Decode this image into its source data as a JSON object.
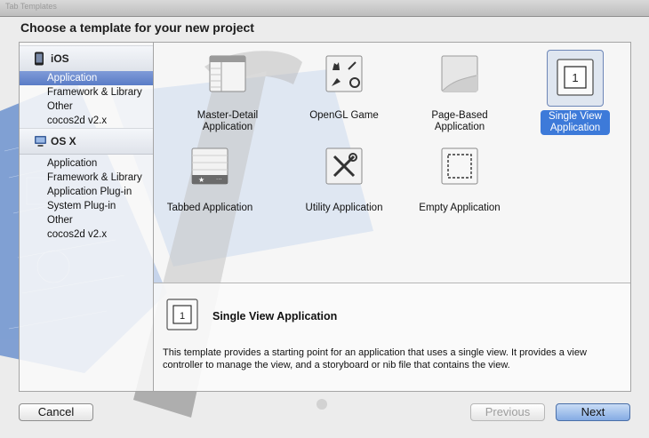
{
  "window": {
    "top_text": "Tab Templates"
  },
  "sheet_title": "Choose a template for your new project",
  "sidebar": {
    "sections": [
      {
        "label": "iOS",
        "icon": "iphone-icon",
        "items": [
          "Application",
          "Framework & Library",
          "Other",
          "cocos2d v2.x"
        ],
        "selected_index": 0
      },
      {
        "label": "OS X",
        "icon": "osx-icon",
        "items": [
          "Application",
          "Framework & Library",
          "Application Plug-in",
          "System Plug-in",
          "Other",
          "cocos2d v2.x"
        ]
      }
    ]
  },
  "templates": [
    {
      "label": "Master-Detail\nApplication",
      "icon": "master-detail-icon"
    },
    {
      "label": "OpenGL Game",
      "icon": "opengl-game-icon"
    },
    {
      "label": "Page-Based\nApplication",
      "icon": "page-based-icon"
    },
    {
      "label": "Single View\nApplication",
      "icon": "single-view-icon",
      "selected": true
    },
    {
      "label": "Tabbed Application",
      "icon": "tabbed-icon"
    },
    {
      "label": "Utility Application",
      "icon": "utility-icon"
    },
    {
      "label": "Empty Application",
      "icon": "empty-icon"
    }
  ],
  "description": {
    "title": "Single View Application",
    "icon_text": "1",
    "text": "This template provides a starting point for an application that uses a single view. It provides a view controller to manage the view, and a storyboard or nib file that contains the view."
  },
  "buttons": {
    "cancel": "Cancel",
    "previous": "Previous",
    "next": "Next"
  },
  "colors": {
    "selection": "#3d7ad9",
    "sidebar_selection": "#5a7cc6",
    "blueprint": "#5a82c8"
  }
}
